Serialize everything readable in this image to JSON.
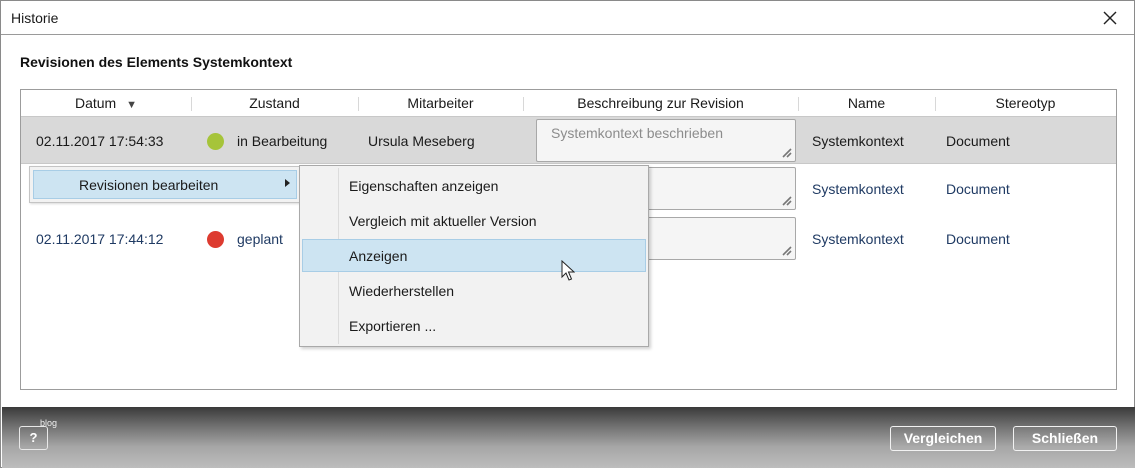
{
  "window": {
    "title": "Historie"
  },
  "section": {
    "title": "Revisionen des Elements Systemkontext"
  },
  "table": {
    "headers": {
      "datum": "Datum",
      "zustand": "Zustand",
      "mitarbeiter": "Mitarbeiter",
      "beschreibung": "Beschreibung zur Revision",
      "name": "Name",
      "stereotyp": "Stereotyp"
    },
    "sort_indicator": "▼",
    "rows": [
      {
        "datum": "02.11.2017 17:54:33",
        "status_color": "#a6c43a",
        "zustand": "in Bearbeitung",
        "mitarbeiter": "Ursula Meseberg",
        "beschreibung": "Systemkontext beschrieben",
        "name": "Systemkontext",
        "stereotyp": "Document"
      },
      {
        "datum": "",
        "status_color": "",
        "zustand": "",
        "mitarbeiter": "",
        "beschreibung": "",
        "name": "Systemkontext",
        "stereotyp": "Document"
      },
      {
        "datum": "02.11.2017 17:44:12",
        "status_color": "#dd3b30",
        "zustand": "geplant",
        "mitarbeiter": "",
        "beschreibung": "",
        "name": "Systemkontext",
        "stereotyp": "Document"
      }
    ]
  },
  "context_menu": {
    "item": "Revisionen bearbeiten",
    "submenu": [
      "Eigenschaften anzeigen",
      "Vergleich mit aktueller Version",
      "Anzeigen",
      "Wiederherstellen",
      "Exportieren ..."
    ],
    "hovered": "Anzeigen"
  },
  "footer": {
    "help_label": "?",
    "blog_label": "blog",
    "compare_label": "Vergleichen",
    "close_label": "Schließen"
  }
}
